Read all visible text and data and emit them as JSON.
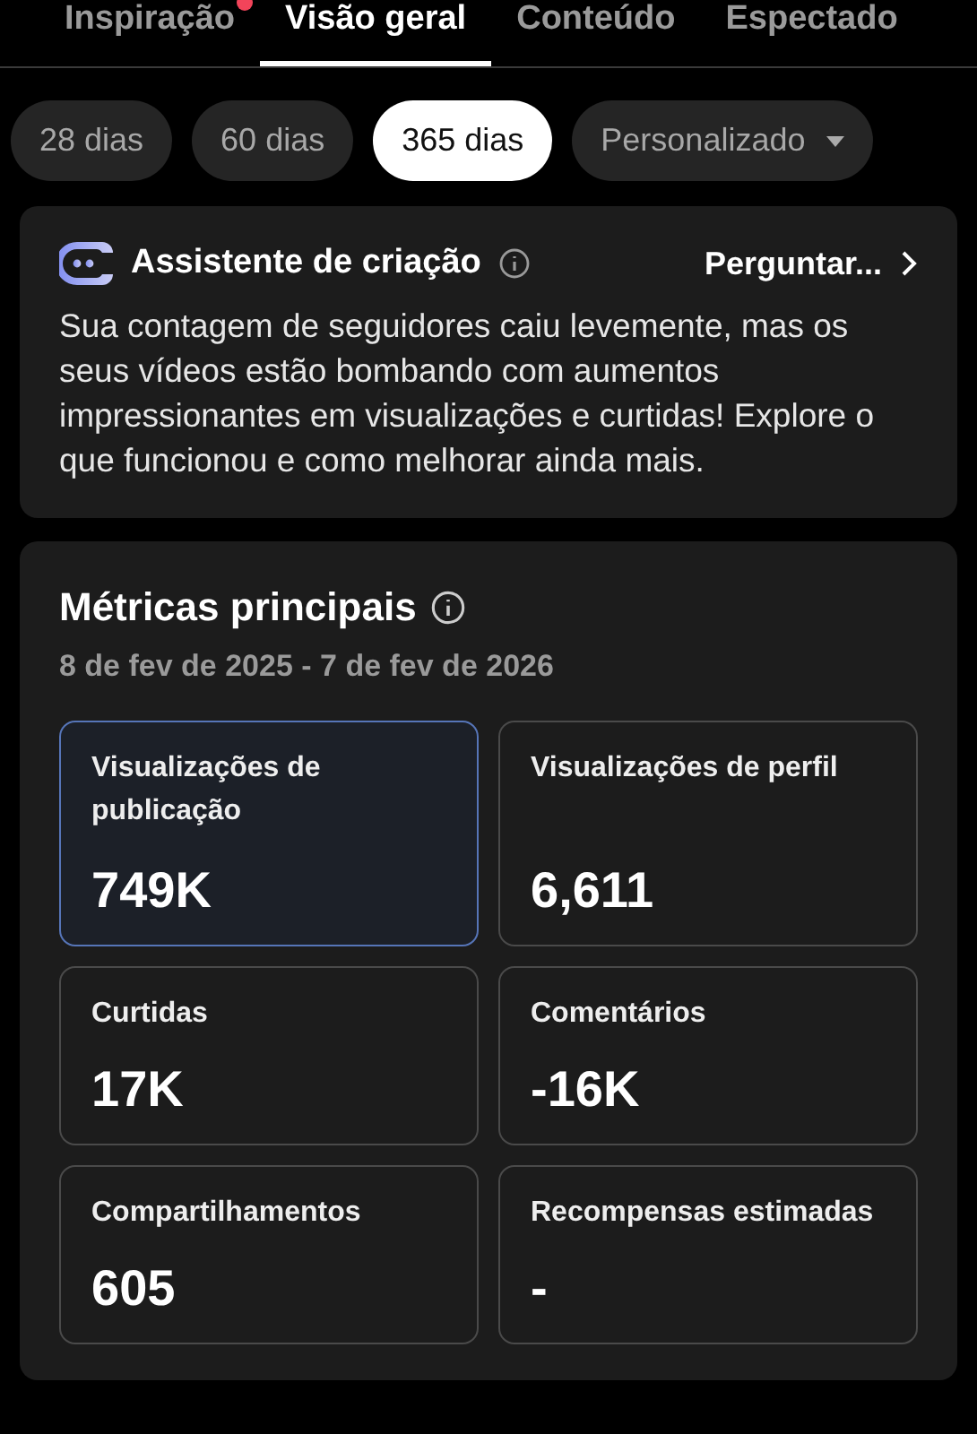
{
  "tabs": [
    {
      "label": "Inspiração",
      "selected": false,
      "notification": true
    },
    {
      "label": "Visão geral",
      "selected": true,
      "notification": false
    },
    {
      "label": "Conteúdo",
      "selected": false,
      "notification": false
    },
    {
      "label": "Espectado",
      "selected": false,
      "notification": false
    }
  ],
  "ranges": [
    {
      "label": "28 dias",
      "selected": false,
      "dropdown": false
    },
    {
      "label": "60 dias",
      "selected": false,
      "dropdown": false
    },
    {
      "label": "365 dias",
      "selected": true,
      "dropdown": false
    },
    {
      "label": "Personalizado",
      "selected": false,
      "dropdown": true
    }
  ],
  "assistant": {
    "title": "Assistente de criação",
    "action": "Perguntar...",
    "text": "Sua contagem de seguidores caiu levemente, mas os seus vídeos estão bombando com aumentos impressionantes em visualizações e curtidas! Explore o que funcionou e como melhorar ainda mais."
  },
  "metrics": {
    "title": "Métricas principais",
    "date_range": "8 de fev de 2025 - 7 de fev de 2026",
    "cards": [
      {
        "label": "Visualizações de publicação",
        "value": "749K",
        "selected": true
      },
      {
        "label": "Visualizações de perfil",
        "value": "6,611",
        "selected": false
      },
      {
        "label": "Curtidas",
        "value": "17K",
        "selected": false
      },
      {
        "label": "Comentários",
        "value": "-16K",
        "selected": false
      },
      {
        "label": "Compartilhamentos",
        "value": "605",
        "selected": false
      },
      {
        "label": "Recompensas estimadas",
        "value": "-",
        "selected": false
      }
    ]
  }
}
